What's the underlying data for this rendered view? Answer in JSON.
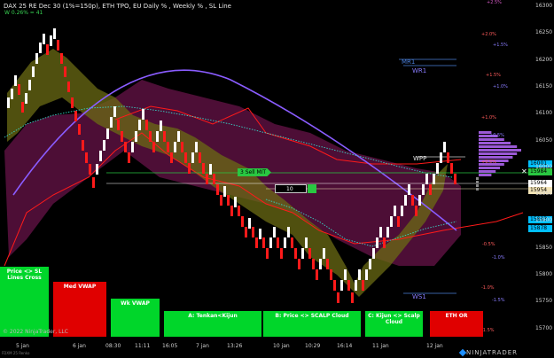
{
  "header": {
    "title": "DAX 25 RE Dec 30 (1%=150p), ETH TPO, EU Daily % , Weekly % , SL Line",
    "subtitle": "W 0.26% = 41"
  },
  "price_axis": [
    "16300",
    "16250",
    "16200",
    "16150",
    "16100",
    "16050",
    "16000",
    "15950",
    "15900",
    "15850",
    "15800",
    "15750",
    "15700"
  ],
  "time_axis": [
    "5 jan",
    "6 jan",
    "08:30",
    "11:11",
    "16:05",
    "7 jan",
    "13:26",
    "10 jan",
    "10:29",
    "16:14",
    "11 jan",
    "12 jan"
  ],
  "percent_levels": [
    {
      "label": "+2.5%",
      "color": "#d85cc8"
    },
    {
      "label": "+2.0%",
      "color": "#ff5c5c"
    },
    {
      "label": "+1.5%",
      "color": "#8a7dff"
    },
    {
      "label": "+1.5%",
      "color": "#ff5c5c"
    },
    {
      "label": "+1.0%",
      "color": "#8a7dff"
    },
    {
      "label": "+1.0%",
      "color": "#ff5c5c"
    },
    {
      "label": "+0.5%",
      "color": "#8a7dff"
    },
    {
      "label": "+0.5%",
      "color": "#ff5c5c"
    },
    {
      "label": "-0.5%",
      "color": "#ff5c5c"
    },
    {
      "label": "-1.0%",
      "color": "#8a7dff"
    },
    {
      "label": "-1.0%",
      "color": "#ff5c5c"
    },
    {
      "label": "-1.5%",
      "color": "#8a7dff"
    },
    {
      "label": "-1.5%",
      "color": "#ff5c5c"
    }
  ],
  "levels": {
    "mr1": "MR1",
    "wr1": "WR1",
    "ws1": "WS1",
    "wpp": "WPP",
    "sell_order": "3  Sell MIT",
    "qty_box": "10"
  },
  "price_tags": [
    {
      "value": "16001",
      "bg": "#00bfff",
      "fg": "#000000"
    },
    {
      "value": "15984",
      "bg": "#29c741",
      "fg": "#000000"
    },
    {
      "value": "15964",
      "bg": "#ffffff",
      "fg": "#000000"
    },
    {
      "value": "15954",
      "bg": "#f2e3b6",
      "fg": "#000000"
    },
    {
      "value": "15893",
      "bg": "#00bfff",
      "fg": "#000000"
    },
    {
      "value": "15878",
      "bg": "#00bfff",
      "fg": "#000000"
    }
  ],
  "panels": [
    {
      "label": "Price <> SL Lines Cross",
      "color": "#00d62a"
    },
    {
      "label": "Med VWAP",
      "color": "#e00000"
    },
    {
      "label": "Wk VWAP",
      "color": "#00d62a"
    },
    {
      "label": "A: Tenkan<Kijun",
      "color": "#00d62a"
    },
    {
      "label": "B: Price <> SCALP Cloud",
      "color": "#00d62a"
    },
    {
      "label": "C: Kijun <> Scalp Cloud",
      "color": "#00d62a"
    },
    {
      "label": "ETH OR",
      "color": "#e00000"
    }
  ],
  "footer": {
    "copyright": "© 2022 NinjaTrader, LLC",
    "brand": "NINJATRADER",
    "instrument": "FDXM 25 Renko"
  },
  "colors": {
    "up": "#ffffff",
    "down": "#ff1a1a",
    "cloud_pink": "#5a1040",
    "cloud_gold": "#5a5a10",
    "arc": "#8a5cff",
    "cyan": "#38d6c8"
  }
}
